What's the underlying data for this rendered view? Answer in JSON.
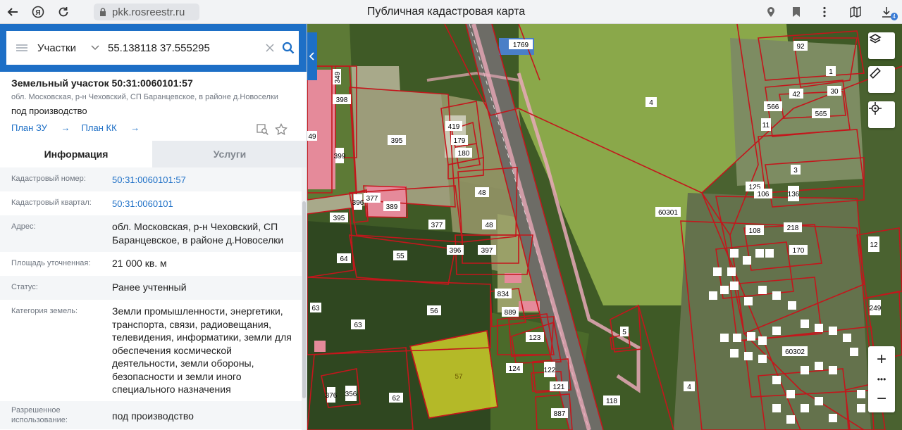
{
  "browser": {
    "url": "pkk.rosreestr.ru",
    "title": "Публичная кадастровая карта",
    "download_badge": "4"
  },
  "search": {
    "type": "Участки",
    "value": "55.138118 37.555295"
  },
  "parcel": {
    "title": "Земельный участок 50:31:0060101:57",
    "address_short": "обл. Московская, р-н Чеховский, СП Баранцевское, в районе д.Новоселки",
    "use": "под производство",
    "plan_zu": "План ЗУ",
    "plan_kk": "План КК"
  },
  "tabs": {
    "info": "Информация",
    "services": "Услуги"
  },
  "info_rows": [
    {
      "label": "Кадастровый номер:",
      "value": "50:31:0060101:57",
      "link": true
    },
    {
      "label": "Кадастровый квартал:",
      "value": "50:31:0060101",
      "link": true
    },
    {
      "label": "Адрес:",
      "value": "обл. Московская, р-н Чеховский, СП Баранцевское, в районе д.Новоселки",
      "link": false
    },
    {
      "label": "Площадь уточненная:",
      "value": "21 000 кв. м",
      "link": false
    },
    {
      "label": "Статус:",
      "value": "Ранее учтенный",
      "link": false
    },
    {
      "label": "Категория земель:",
      "value": "Земли промышленности, энергетики, транспорта, связи, радиовещания, телевидения, информатики, земли для обеспечения космической деятельности, земли обороны, безопасности и земли иного специального назначения",
      "link": false
    },
    {
      "label": "Разрешенное использование:",
      "value": "под производство",
      "link": false
    }
  ],
  "map": {
    "parcel_labels": [
      {
        "t": "1769"
      },
      {
        "t": "398"
      },
      {
        "t": "349"
      },
      {
        "t": "419"
      },
      {
        "t": "179"
      },
      {
        "t": "180"
      },
      {
        "t": "395"
      },
      {
        "t": "395"
      },
      {
        "t": "399"
      },
      {
        "t": "377"
      },
      {
        "t": "389"
      },
      {
        "t": "396"
      },
      {
        "t": "377"
      },
      {
        "t": "48"
      },
      {
        "t": "48"
      },
      {
        "t": "396"
      },
      {
        "t": "397"
      },
      {
        "t": "64"
      },
      {
        "t": "55"
      },
      {
        "t": "56"
      },
      {
        "t": "63"
      },
      {
        "t": "63"
      },
      {
        "t": "834"
      },
      {
        "t": "889"
      },
      {
        "t": "123"
      },
      {
        "t": "124"
      },
      {
        "t": "122"
      },
      {
        "t": "121"
      },
      {
        "t": "887"
      },
      {
        "t": "118"
      },
      {
        "t": "62"
      },
      {
        "t": "376"
      },
      {
        "t": "356"
      },
      {
        "t": "57"
      },
      {
        "t": "5"
      },
      {
        "t": "4"
      },
      {
        "t": "4"
      },
      {
        "t": "60301"
      },
      {
        "t": "92"
      },
      {
        "t": "1"
      },
      {
        "t": "30"
      },
      {
        "t": "42"
      },
      {
        "t": "566"
      },
      {
        "t": "565"
      },
      {
        "t": "11"
      },
      {
        "t": "3"
      },
      {
        "t": "125"
      },
      {
        "t": "106"
      },
      {
        "t": "136"
      },
      {
        "t": "218"
      },
      {
        "t": "108"
      },
      {
        "t": "170"
      },
      {
        "t": "60302"
      },
      {
        "t": "12"
      },
      {
        "t": "249"
      },
      {
        "t": "49"
      }
    ],
    "colors": {
      "boundary": "#c4161c",
      "selected_fill": "#d6d62a",
      "road": "#e8a9b8",
      "building": "#e58a9a"
    }
  },
  "controls": {
    "zoom_in": "+",
    "zoom_more": "•••",
    "zoom_out": "−"
  }
}
